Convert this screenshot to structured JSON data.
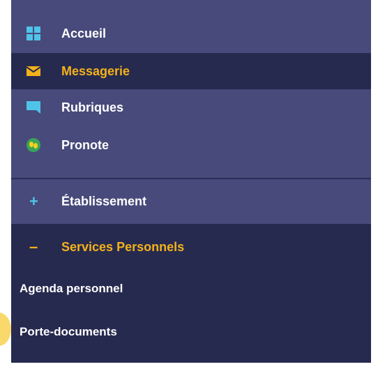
{
  "menu": {
    "items": [
      {
        "label": "Accueil",
        "icon": "grid-icon"
      },
      {
        "label": "Messagerie",
        "icon": "envelope-icon"
      },
      {
        "label": "Rubriques",
        "icon": "chat-bubble-icon"
      },
      {
        "label": "Pronote",
        "icon": "butterfly-icon"
      }
    ],
    "sections": [
      {
        "label": "Établissement",
        "toggle": "+"
      },
      {
        "label": "Services Personnels",
        "toggle": "–"
      }
    ],
    "subitems": [
      {
        "label": "Agenda personnel"
      },
      {
        "label": "Porte-documents"
      }
    ]
  },
  "colors": {
    "panel_light": "#474a7a",
    "panel_dark": "#272a4f",
    "accent": "#f3b21b",
    "icon_blue": "#4fc3e8"
  }
}
